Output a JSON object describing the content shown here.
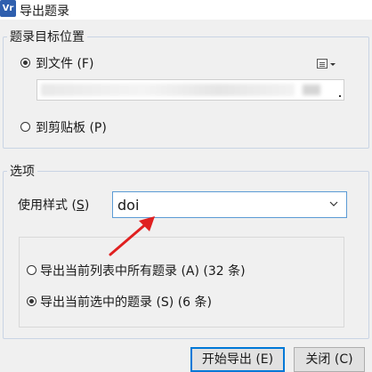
{
  "window": {
    "title": "导出题录",
    "icon_text": "Vr"
  },
  "target_group": {
    "legend": "题录目标位置",
    "to_file_label": "到文件 (F)",
    "to_clipboard_label": "到剪贴板 (P)",
    "selected": "to_file"
  },
  "options_group": {
    "legend": "选项",
    "style_label": "使用样式 (",
    "style_mnemonic": "S",
    "style_label_end": ")",
    "style_value": "doi",
    "export_all_label": "导出当前列表中所有题录 (A) (32 条)",
    "export_selected_label": "导出当前选中的题录 (S) (6 条)",
    "selected": "export_selected"
  },
  "buttons": {
    "start_export": "开始导出 (E)",
    "close": "关闭 (C)"
  },
  "colors": {
    "arrow": "#e02020",
    "focus_border": "#0078d7",
    "combo_border": "#5b9bd5",
    "group_border": "#c9d4e4"
  }
}
